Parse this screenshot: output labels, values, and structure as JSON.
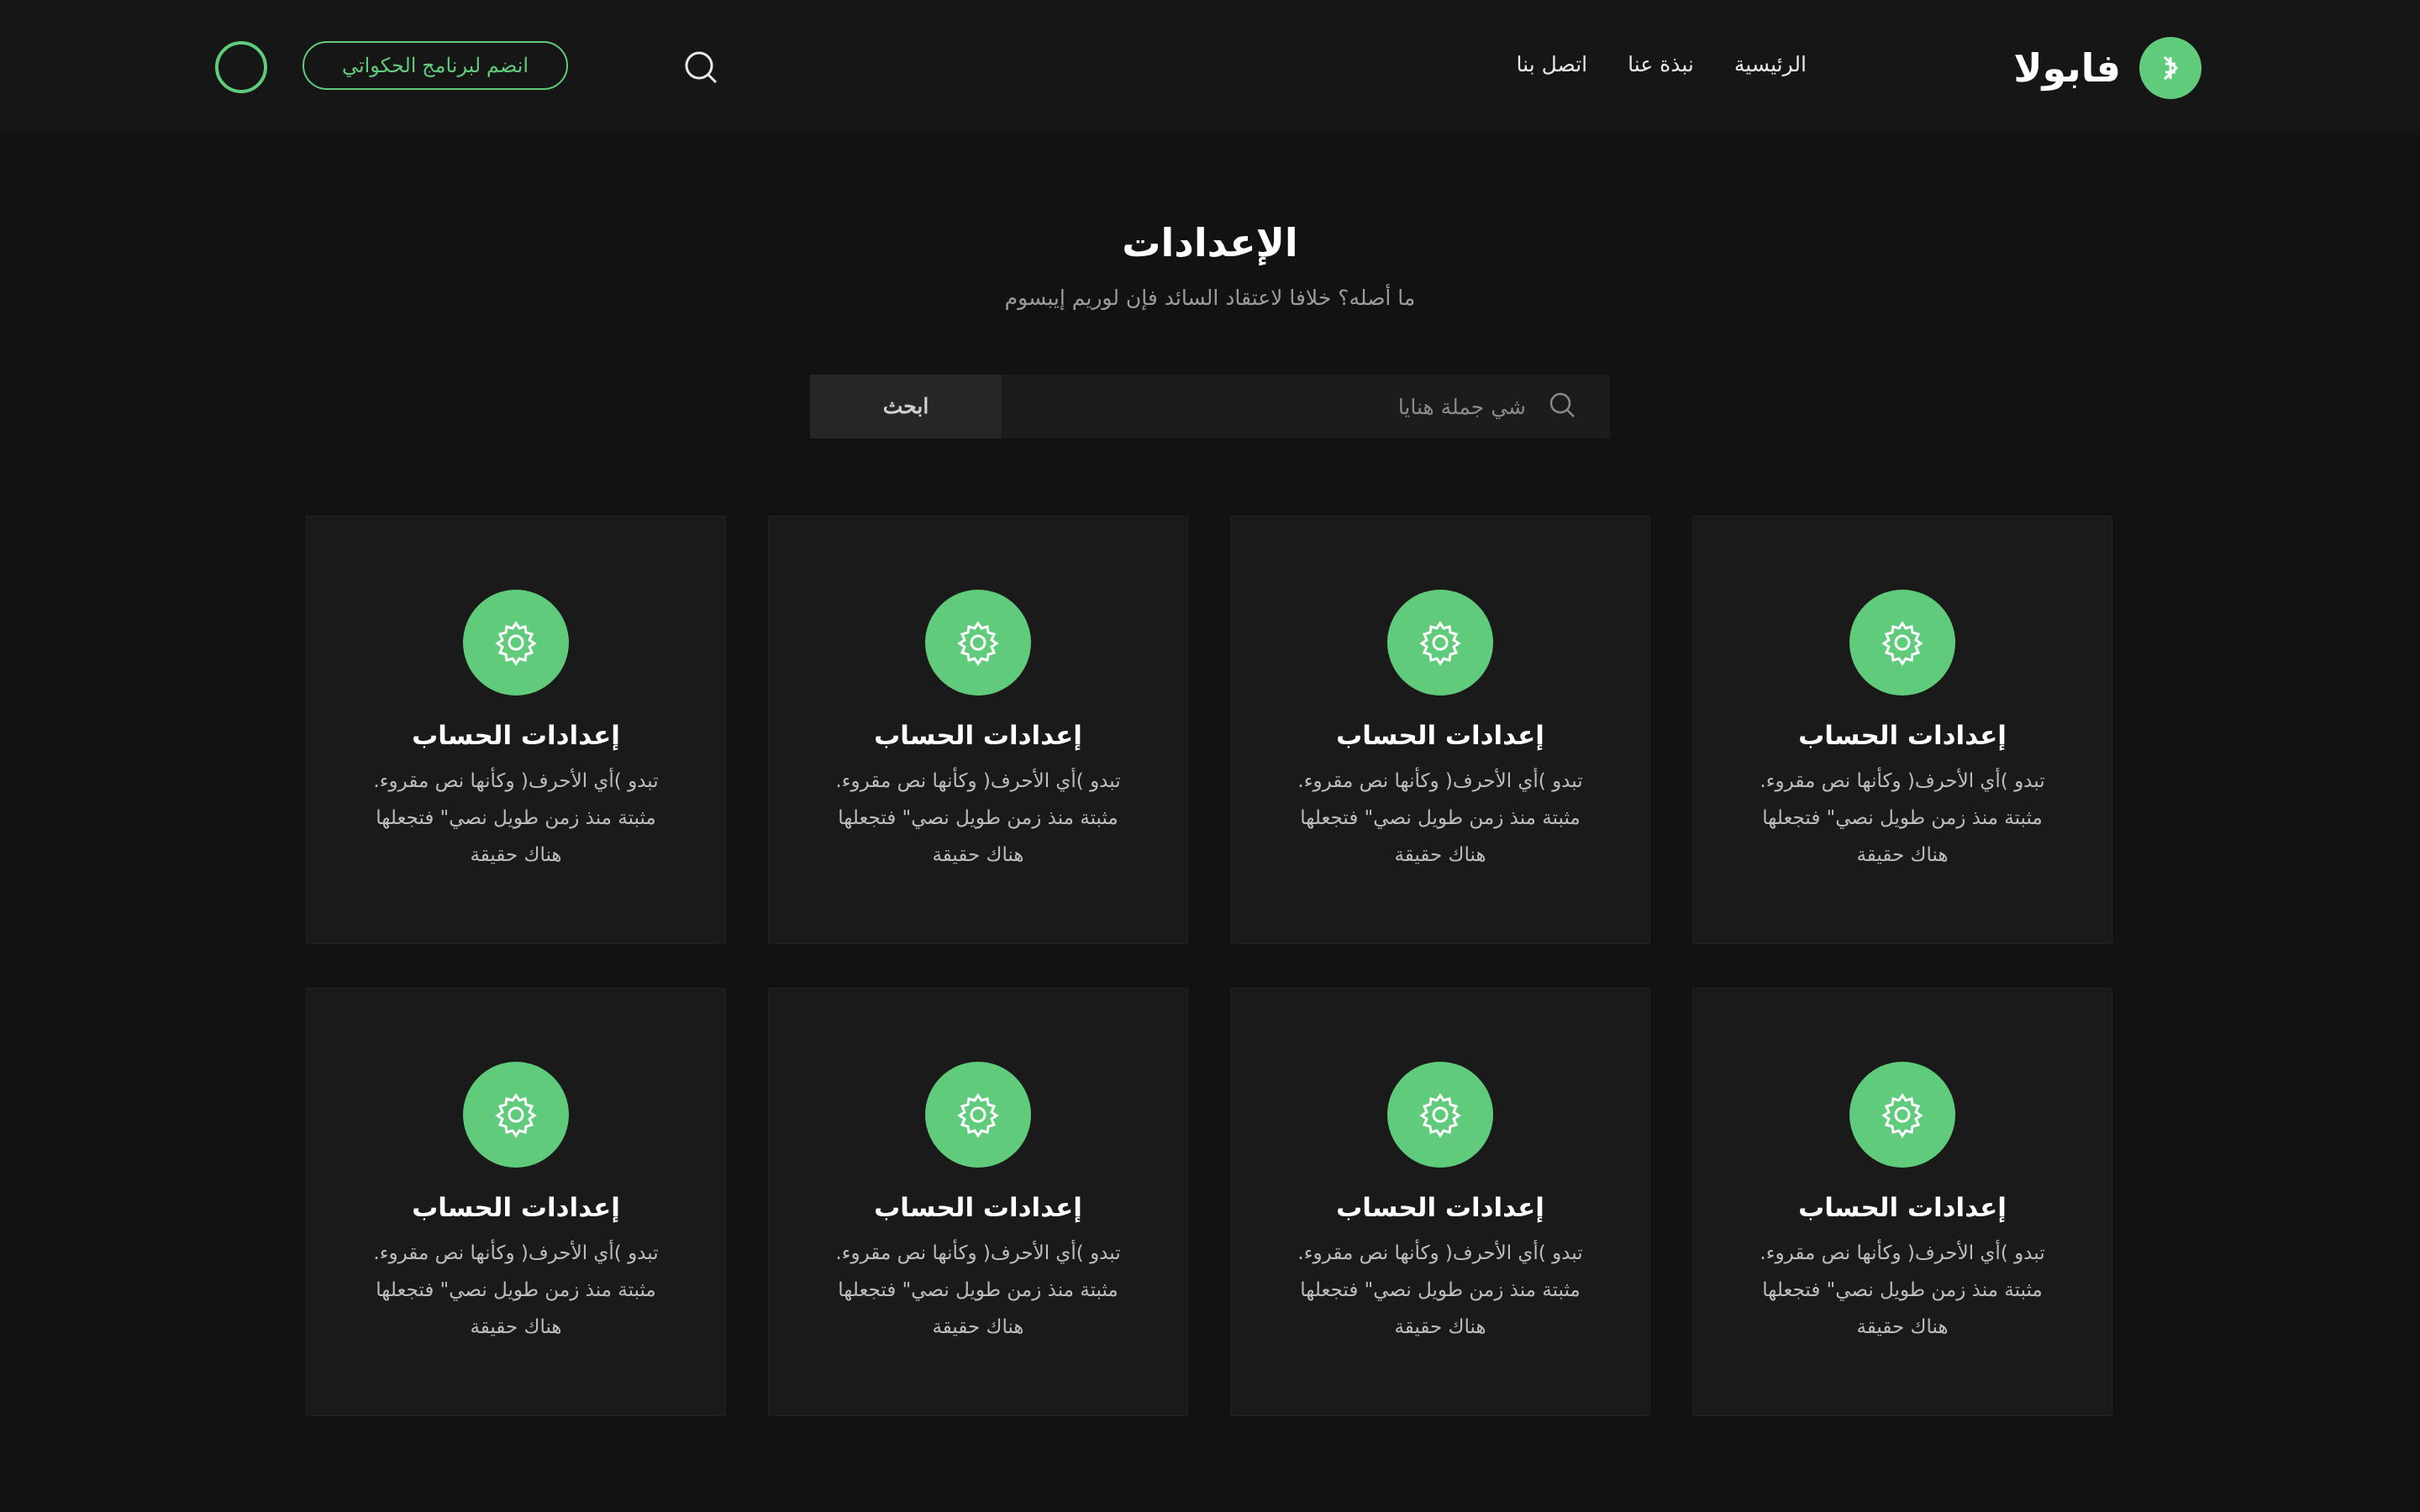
{
  "brand": {
    "name": "فابولا",
    "logo_icon": "leaf-logo-icon"
  },
  "nav": {
    "items": [
      "الرئيسية",
      "نبذة عنا",
      "اتصل بنا"
    ]
  },
  "header": {
    "search_icon": "search-icon",
    "join_label": "انضم لبرنامج الحكواتي"
  },
  "hero": {
    "title": "الإعدادات",
    "subtitle": "ما أصله؟ خلافا لاعتقاد السائد فإن لوريم إيبسوم"
  },
  "search": {
    "placeholder": "شي جملة هنايا",
    "button_label": "ابحث"
  },
  "cards": [
    {
      "icon": "gear-icon",
      "title": "إعدادات الحساب",
      "text": "تبدو )أي الأحرف( وكأنها نص مقروء. مثبتة منذ زمن طويل نصي\" فتجعلها هناك حقيقة"
    },
    {
      "icon": "gear-icon",
      "title": "إعدادات الحساب",
      "text": "تبدو )أي الأحرف( وكأنها نص مقروء. مثبتة منذ زمن طويل نصي\" فتجعلها هناك حقيقة"
    },
    {
      "icon": "gear-icon",
      "title": "إعدادات الحساب",
      "text": "تبدو )أي الأحرف( وكأنها نص مقروء. مثبتة منذ زمن طويل نصي\" فتجعلها هناك حقيقة"
    },
    {
      "icon": "gear-icon",
      "title": "إعدادات الحساب",
      "text": "تبدو )أي الأحرف( وكأنها نص مقروء. مثبتة منذ زمن طويل نصي\" فتجعلها هناك حقيقة"
    },
    {
      "icon": "gear-icon",
      "title": "إعدادات الحساب",
      "text": "تبدو )أي الأحرف( وكأنها نص مقروء. مثبتة منذ زمن طويل نصي\" فتجعلها هناك حقيقة"
    },
    {
      "icon": "gear-icon",
      "title": "إعدادات الحساب",
      "text": "تبدو )أي الأحرف( وكأنها نص مقروء. مثبتة منذ زمن طويل نصي\" فتجعلها هناك حقيقة"
    },
    {
      "icon": "gear-icon",
      "title": "إعدادات الحساب",
      "text": "تبدو )أي الأحرف( وكأنها نص مقروء. مثبتة منذ زمن طويل نصي\" فتجعلها هناك حقيقة"
    },
    {
      "icon": "gear-icon",
      "title": "إعدادات الحساب",
      "text": "تبدو )أي الأحرف( وكأنها نص مقروء. مثبتة منذ زمن طويل نصي\" فتجعلها هناك حقيقة"
    }
  ],
  "colors": {
    "accent": "#5fcb7b",
    "background": "#121212",
    "card": "#1a1a1a"
  }
}
